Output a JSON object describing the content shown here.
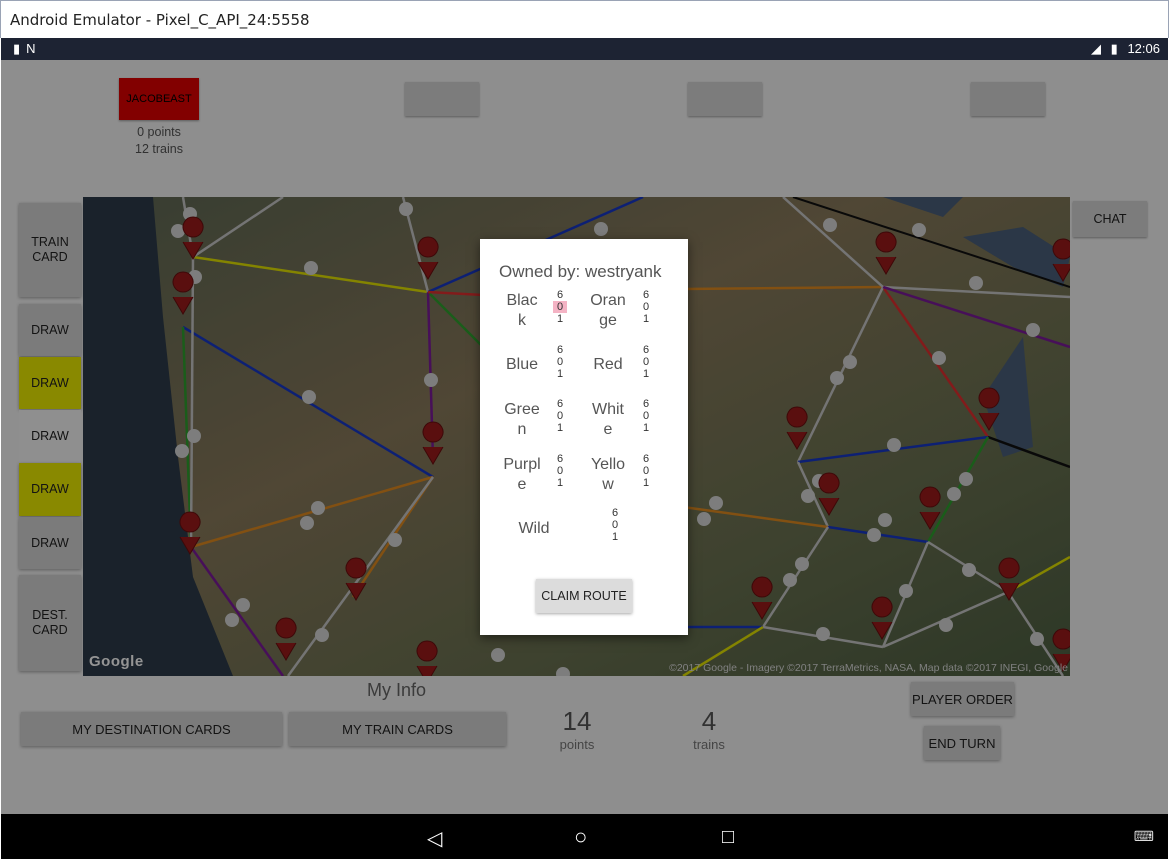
{
  "window": {
    "title": "Android Emulator - Pixel_C_API_24:5558"
  },
  "status_bar": {
    "time": "12:06",
    "left_icons": [
      "sd-card-icon",
      "n-icon"
    ],
    "right_icons": [
      "lte-signal-icon",
      "battery-charging-icon"
    ]
  },
  "players": [
    {
      "name": "JACOBEAST",
      "points": "0 points",
      "trains": "12 trains",
      "color": "#e00000"
    },
    {
      "name": "",
      "points": "",
      "trains": ""
    },
    {
      "name": "",
      "points": "",
      "trains": ""
    },
    {
      "name": "",
      "points": "",
      "trains": ""
    }
  ],
  "side_buttons": {
    "train_card": "TRAIN CARD",
    "draw": [
      "DRAW",
      "DRAW",
      "DRAW",
      "DRAW",
      "DRAW"
    ],
    "draw_colors": [
      "#d5d5d5",
      "#eded00",
      "#f6f6f6",
      "#eded00",
      "#d5d5d5"
    ],
    "dest_card": "DEST. CARD"
  },
  "chat_label": "CHAT",
  "map": {
    "google_logo": "Google",
    "attribution": "©2017 Google - Imagery ©2017 TerraMetrics, NASA, Map data ©2017 INEGI, Google"
  },
  "dialog": {
    "owned_by": "Owned by: westryank",
    "colors": [
      {
        "label": "Blac\nk",
        "values": [
          "6",
          "0",
          "1"
        ]
      },
      {
        "label": "Oran\nge",
        "values": [
          "6",
          "0",
          "1"
        ]
      },
      {
        "label": "Blue",
        "values": [
          "6",
          "0",
          "1"
        ]
      },
      {
        "label": "Red",
        "values": [
          "6",
          "0",
          "1"
        ]
      },
      {
        "label": "Gree\nn",
        "values": [
          "6",
          "0",
          "1"
        ]
      },
      {
        "label": "White\ne",
        "values": [
          "6",
          "0",
          "1"
        ]
      },
      {
        "label": "Purpl\ne",
        "values": [
          "6",
          "0",
          "1"
        ]
      },
      {
        "label": "Yello\nw",
        "values": [
          "6",
          "0",
          "1"
        ]
      }
    ],
    "wild": {
      "label": "Wild",
      "values": [
        "6",
        "0",
        "1"
      ]
    },
    "claim_label": "CLAIM ROUTE"
  },
  "my_info": {
    "heading": "My Info",
    "dest_cards_label": "MY DESTINATION CARDS",
    "train_cards_label": "MY TRAIN CARDS",
    "points_value": "14",
    "points_label": "points",
    "trains_value": "4",
    "trains_label": "trains",
    "player_order_label": "PLAYER ORDER",
    "end_turn_label": "END TURN"
  },
  "nav_bar": {
    "icons": [
      "back-icon",
      "home-icon",
      "recents-icon",
      "keyboard-icon"
    ]
  }
}
